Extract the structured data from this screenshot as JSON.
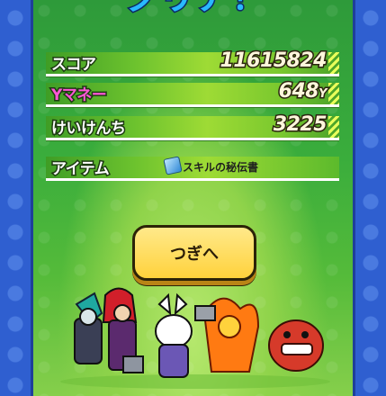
{
  "title": "クリア！",
  "results": {
    "score": {
      "label": "スコア",
      "value": "11615824"
    },
    "money": {
      "label": "Yマネー",
      "value": "648",
      "unit": "Y"
    },
    "exp": {
      "label": "けいけんち",
      "value": "3225"
    },
    "item": {
      "label": "アイテム",
      "name": "スキルの秘伝書",
      "icon": "scroll-icon"
    }
  },
  "next_button": {
    "label": "つぎへ"
  },
  "colors": {
    "panel_green": "#3aad3c",
    "button_yellow": "#ffd23c",
    "side_blue": "#2f5fd0"
  }
}
